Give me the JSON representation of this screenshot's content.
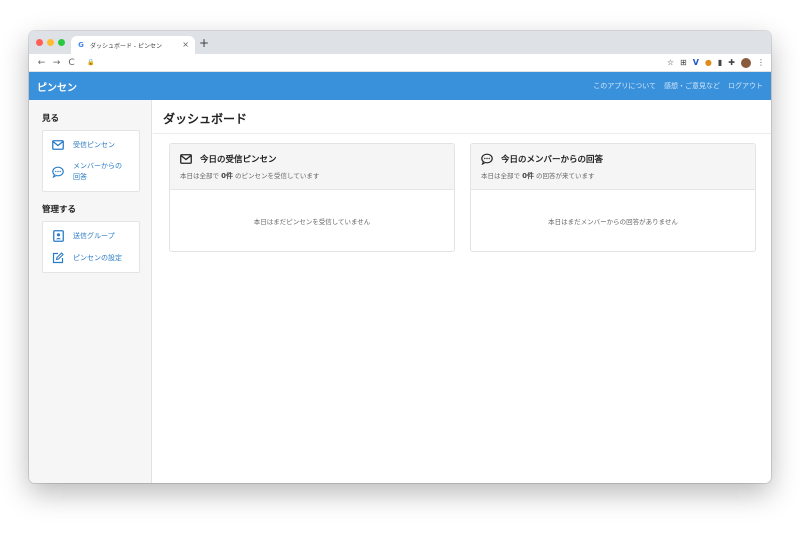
{
  "browser": {
    "tab_title": "ダッシュボード - ピンセン",
    "tab_favicon": "G",
    "tab_close": "×",
    "new_tab": "+",
    "back": "←",
    "forward": "→",
    "reload": "C",
    "lock": "🔒",
    "star": "☆",
    "ext_grid": "⊞",
    "ext_v": "V",
    "ext_orange": "●",
    "ext_book": "▮",
    "ext_puzzle": "✚",
    "menu": "⋮"
  },
  "app": {
    "brand": "ピンセン",
    "nav": [
      "このアプリについて",
      "感想・ご意見など",
      "ログアウト"
    ],
    "accent": "#3990db"
  },
  "sidebar": {
    "sections": [
      {
        "title": "見る",
        "items": [
          {
            "label": "受信ピンセン",
            "icon": "envelope-icon"
          },
          {
            "label": "メンバーからの回答",
            "label_line1": "メンバーからの",
            "label_line2": "回答",
            "icon": "comment-icon"
          }
        ]
      },
      {
        "title": "管理する",
        "items": [
          {
            "label": "送信グループ",
            "icon": "contact-card-icon"
          },
          {
            "label": "ピンセンの設定",
            "icon": "edit-icon"
          }
        ]
      }
    ]
  },
  "main": {
    "title": "ダッシュボード",
    "cards": [
      {
        "title": "今日の受信ピンセン",
        "icon": "envelope-icon",
        "sub_prefix": "本日は全部で",
        "count": "0件",
        "sub_suffix": "のピンセンを受信しています",
        "empty": "本日はまだピンセンを受信していません"
      },
      {
        "title": "今日のメンバーからの回答",
        "icon": "comment-icon",
        "sub_prefix": "本日は全部で",
        "count": "0件",
        "sub_suffix": "の回答が来ています",
        "empty": "本日はまだメンバーからの回答がありません"
      }
    ]
  }
}
